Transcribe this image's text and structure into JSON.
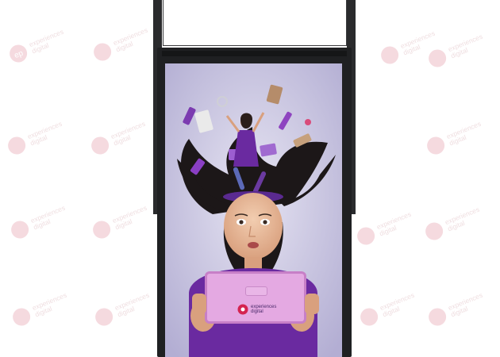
{
  "watermark": {
    "line1": "experiences",
    "line2": "digital"
  },
  "tablet": {
    "brand_line1": "experiences",
    "brand_line2": "digital"
  },
  "colors": {
    "display_frame": "#1f2022",
    "screen_bg": "#cfcbe4",
    "purple": "#6a2aa0",
    "tablet": "#e4a9e2",
    "brand": "#d42350"
  }
}
